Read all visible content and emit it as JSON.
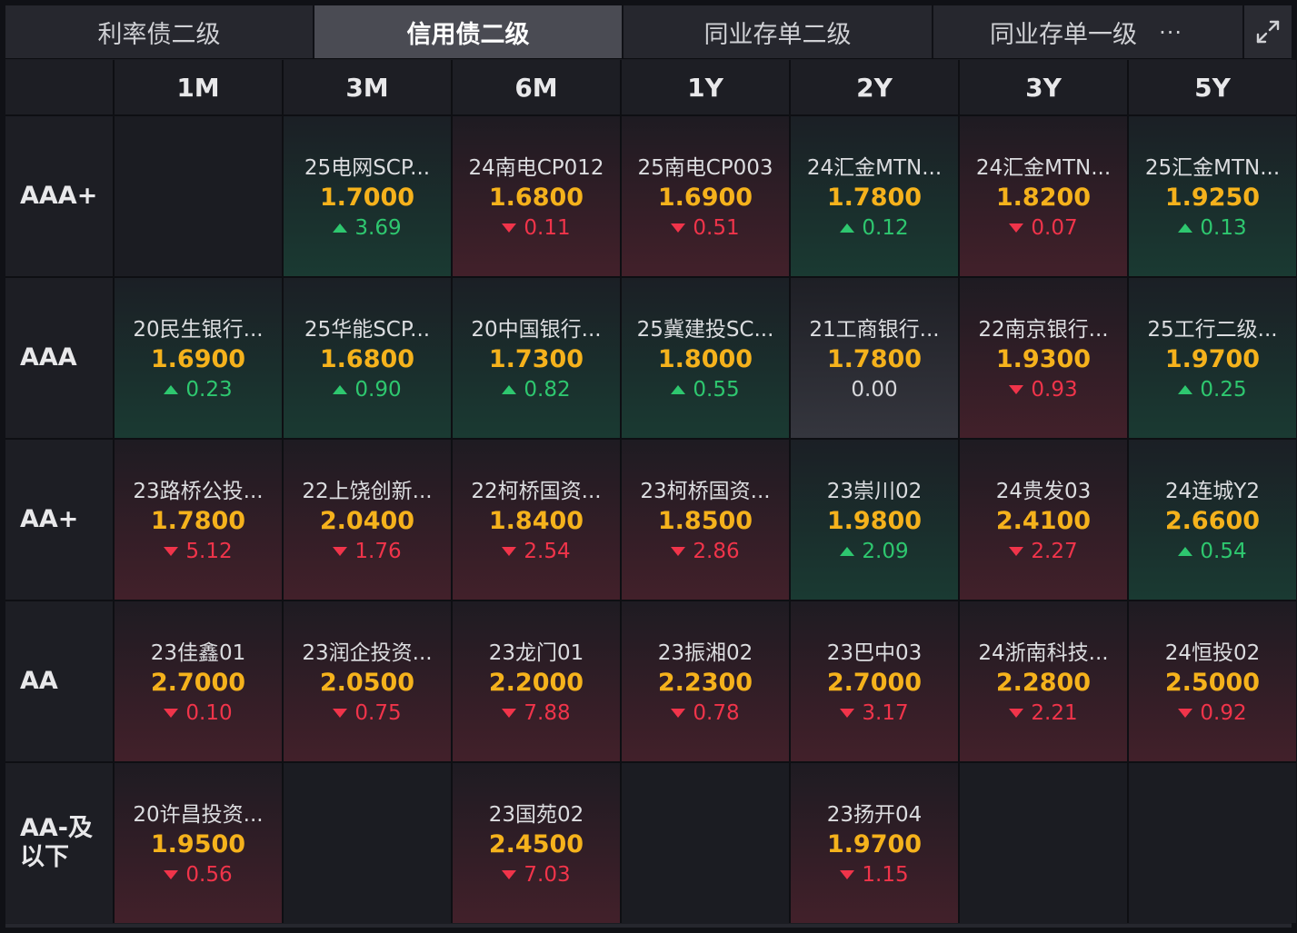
{
  "tabs": [
    {
      "label": "利率债二级",
      "active": false
    },
    {
      "label": "信用债二级",
      "active": true
    },
    {
      "label": "同业存单二级",
      "active": false
    },
    {
      "label": "同业存单一级",
      "active": false
    }
  ],
  "more_label": "···",
  "columns": [
    "1M",
    "3M",
    "6M",
    "1Y",
    "2Y",
    "3Y",
    "5Y"
  ],
  "rows": [
    {
      "label": "AAA+",
      "cells": [
        null,
        {
          "name": "25电网SCP...",
          "yield": "1.7000",
          "change": "3.69",
          "dir": "up"
        },
        {
          "name": "24南电CP012",
          "yield": "1.6800",
          "change": "0.11",
          "dir": "down"
        },
        {
          "name": "25南电CP003",
          "yield": "1.6900",
          "change": "0.51",
          "dir": "down"
        },
        {
          "name": "24汇金MTN...",
          "yield": "1.7800",
          "change": "0.12",
          "dir": "up"
        },
        {
          "name": "24汇金MTN...",
          "yield": "1.8200",
          "change": "0.07",
          "dir": "down"
        },
        {
          "name": "25汇金MTN...",
          "yield": "1.9250",
          "change": "0.13",
          "dir": "up"
        }
      ]
    },
    {
      "label": "AAA",
      "cells": [
        {
          "name": "20民生银行...",
          "yield": "1.6900",
          "change": "0.23",
          "dir": "up"
        },
        {
          "name": "25华能SCP...",
          "yield": "1.6800",
          "change": "0.90",
          "dir": "up"
        },
        {
          "name": "20中国银行...",
          "yield": "1.7300",
          "change": "0.82",
          "dir": "up"
        },
        {
          "name": "25冀建投SC...",
          "yield": "1.8000",
          "change": "0.55",
          "dir": "up"
        },
        {
          "name": "21工商银行...",
          "yield": "1.7800",
          "change": "0.00",
          "dir": "flat"
        },
        {
          "name": "22南京银行...",
          "yield": "1.9300",
          "change": "0.93",
          "dir": "down"
        },
        {
          "name": "25工行二级...",
          "yield": "1.9700",
          "change": "0.25",
          "dir": "up"
        }
      ]
    },
    {
      "label": "AA+",
      "cells": [
        {
          "name": "23路桥公投...",
          "yield": "1.7800",
          "change": "5.12",
          "dir": "down"
        },
        {
          "name": "22上饶创新...",
          "yield": "2.0400",
          "change": "1.76",
          "dir": "down"
        },
        {
          "name": "22柯桥国资...",
          "yield": "1.8400",
          "change": "2.54",
          "dir": "down"
        },
        {
          "name": "23柯桥国资...",
          "yield": "1.8500",
          "change": "2.86",
          "dir": "down"
        },
        {
          "name": "23崇川02",
          "yield": "1.9800",
          "change": "2.09",
          "dir": "up"
        },
        {
          "name": "24贵发03",
          "yield": "2.4100",
          "change": "2.27",
          "dir": "down"
        },
        {
          "name": "24连城Y2",
          "yield": "2.6600",
          "change": "0.54",
          "dir": "up"
        }
      ]
    },
    {
      "label": "AA",
      "cells": [
        {
          "name": "23佳鑫01",
          "yield": "2.7000",
          "change": "0.10",
          "dir": "down"
        },
        {
          "name": "23润企投资...",
          "yield": "2.0500",
          "change": "0.75",
          "dir": "down"
        },
        {
          "name": "23龙门01",
          "yield": "2.2000",
          "change": "7.88",
          "dir": "down"
        },
        {
          "name": "23振湘02",
          "yield": "2.2300",
          "change": "0.78",
          "dir": "down"
        },
        {
          "name": "23巴中03",
          "yield": "2.7000",
          "change": "3.17",
          "dir": "down"
        },
        {
          "name": "24浙南科技...",
          "yield": "2.2800",
          "change": "2.21",
          "dir": "down"
        },
        {
          "name": "24恒投02",
          "yield": "2.5000",
          "change": "0.92",
          "dir": "down"
        }
      ]
    },
    {
      "label": "AA-及以下",
      "cells": [
        {
          "name": "20许昌投资...",
          "yield": "1.9500",
          "change": "0.56",
          "dir": "down"
        },
        null,
        {
          "name": "23国苑02",
          "yield": "2.4500",
          "change": "7.03",
          "dir": "down"
        },
        null,
        {
          "name": "23扬开04",
          "yield": "1.9700",
          "change": "1.15",
          "dir": "down"
        },
        null,
        null
      ]
    }
  ],
  "colors": {
    "up": "#2ec76f",
    "down": "#f0344a",
    "yield": "#f5b21c",
    "active_tab": "#4a4b53"
  }
}
